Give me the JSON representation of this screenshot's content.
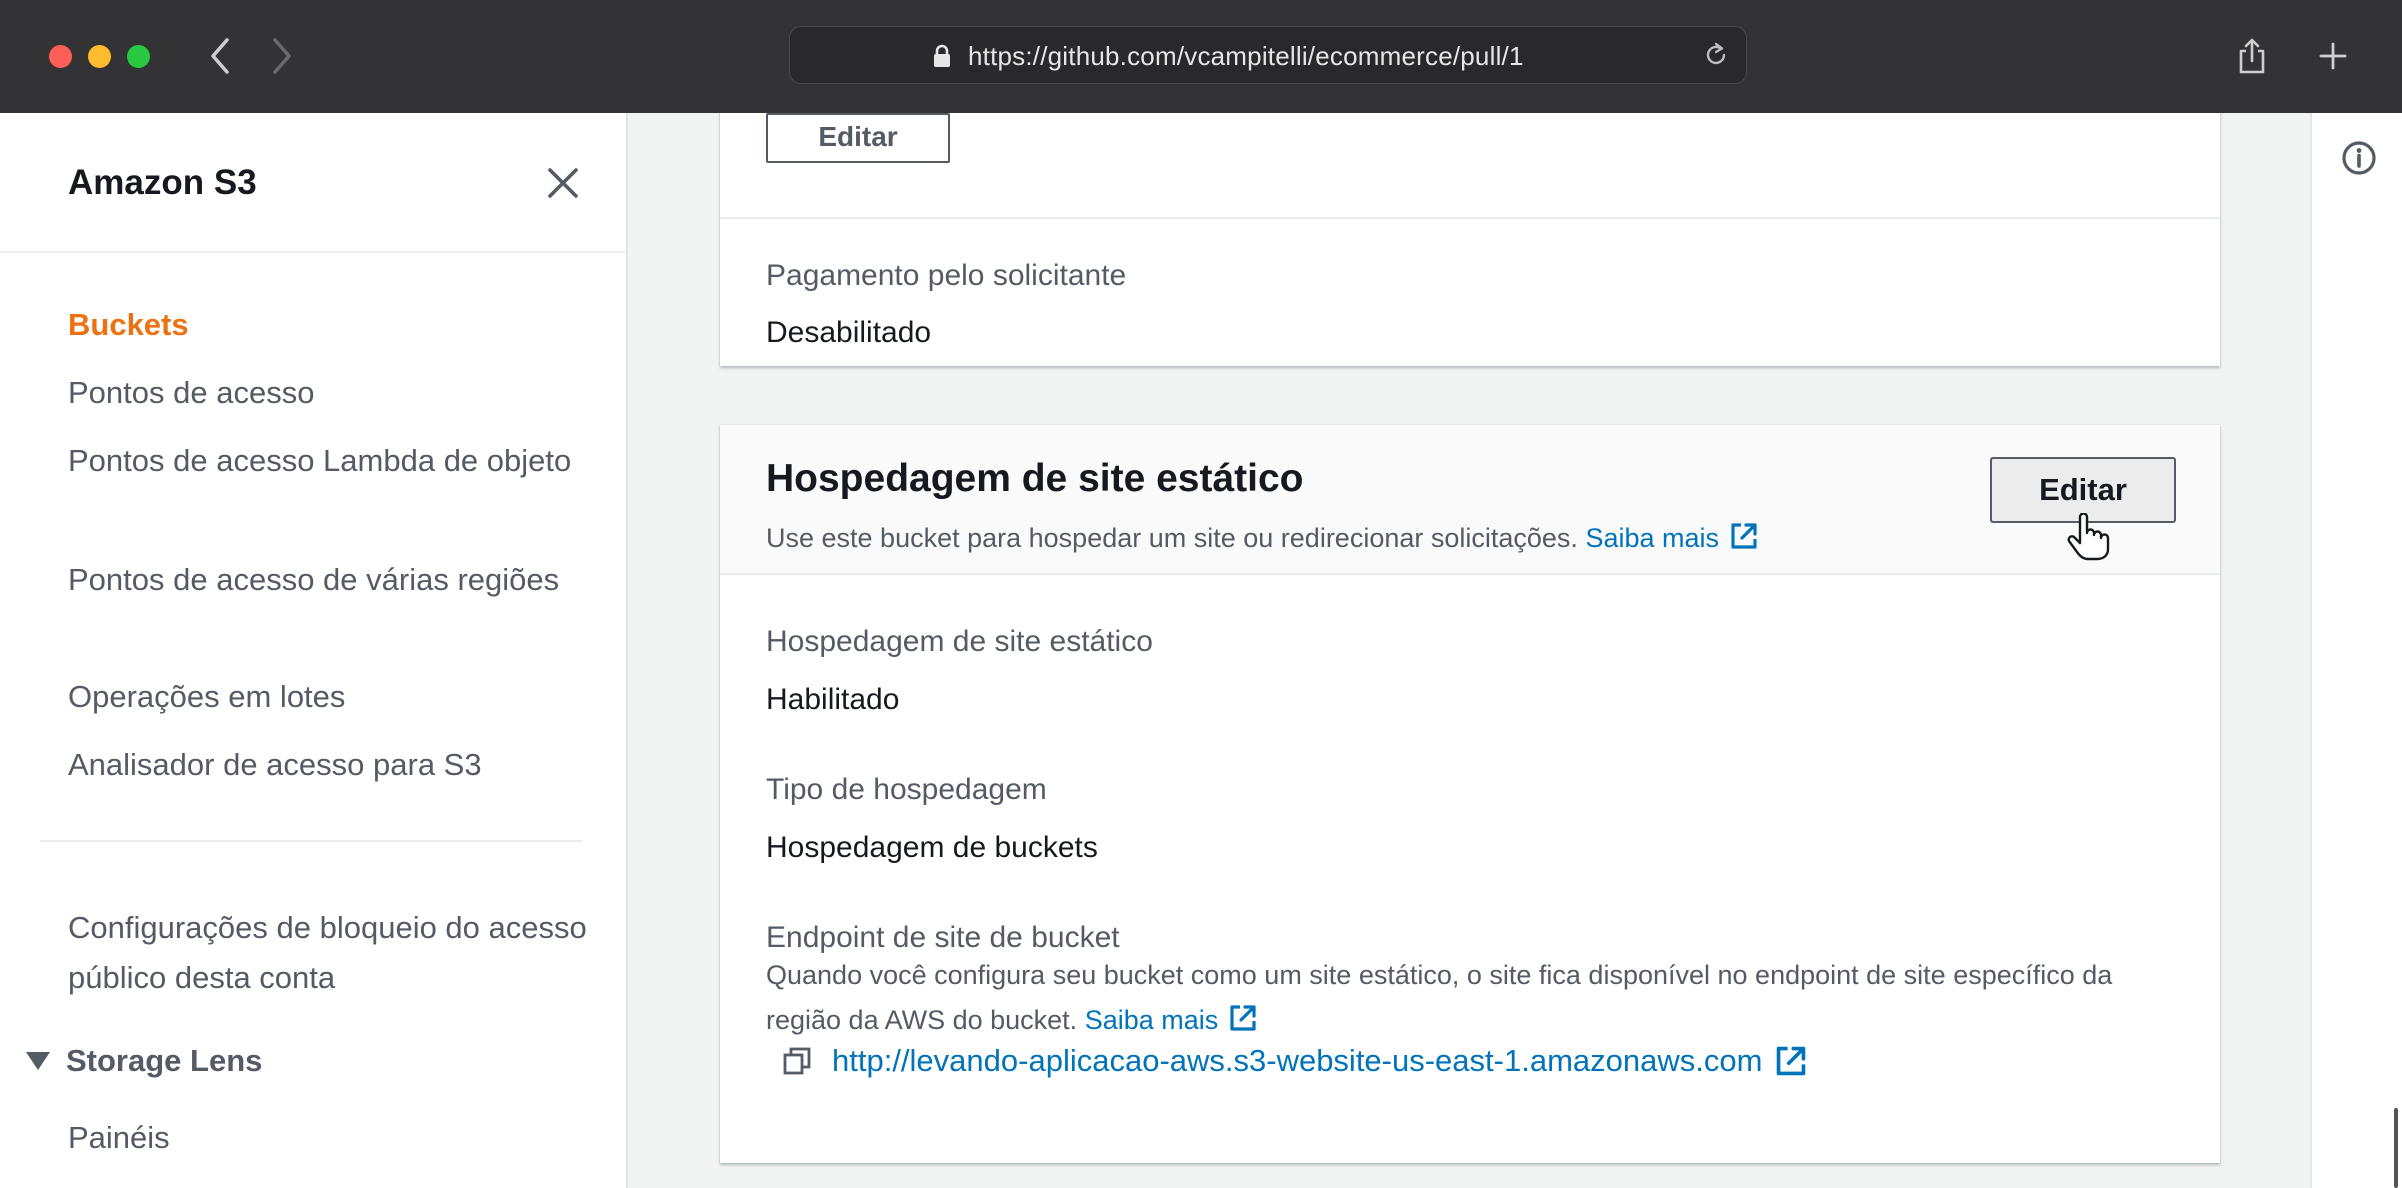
{
  "browser": {
    "url": "https://github.com/vcampitelli/ecommerce/pull/1"
  },
  "sidebar": {
    "title": "Amazon S3",
    "items": [
      {
        "label": "Buckets",
        "active": true
      },
      {
        "label": "Pontos de acesso"
      },
      {
        "label": "Pontos de acesso Lambda de objeto"
      },
      {
        "label": "Pontos de acesso de várias regiões"
      },
      {
        "label": "Operações em lotes"
      },
      {
        "label": "Analisador de acesso para S3"
      }
    ],
    "account_block": "Configurações de bloqueio do acesso público desta conta",
    "storage_lens": {
      "title": "Storage Lens",
      "items": [
        {
          "label": "Painéis"
        }
      ]
    }
  },
  "requester_pays": {
    "edit_label": "Editar",
    "label": "Pagamento pelo solicitante",
    "value": "Desabilitado"
  },
  "static_hosting": {
    "title": "Hospedagem de site estático",
    "description": "Use este bucket para hospedar um site ou redirecionar solicitações.",
    "learn_more": "Saiba mais",
    "edit_label": "Editar",
    "fields": [
      {
        "label": "Hospedagem de site estático",
        "value": "Habilitado"
      },
      {
        "label": "Tipo de hospedagem",
        "value": "Hospedagem de buckets"
      }
    ],
    "endpoint": {
      "label": "Endpoint de site de bucket",
      "description": "Quando você configura seu bucket como um site estático, o site fica disponível no endpoint de site específico da região da AWS do bucket.",
      "learn_more": "Saiba mais",
      "url": "http://levando-aplicacao-aws.s3-website-us-east-1.amazonaws.com"
    }
  },
  "colors": {
    "accent_orange": "#ec7211",
    "link_blue": "#0073bb",
    "chrome_dark": "#333335"
  }
}
